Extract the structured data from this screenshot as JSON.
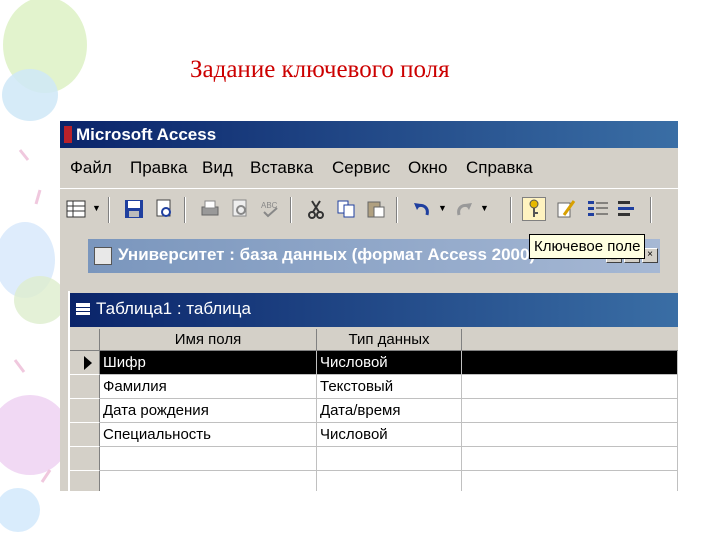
{
  "slide": {
    "title": "Задание ключевого поля"
  },
  "window": {
    "title": "Microsoft Access"
  },
  "menu": [
    "Файл",
    "Правка",
    "Вид",
    "Вставка",
    "Сервис",
    "Окно",
    "Справка"
  ],
  "toolbar": {
    "tooltip": "Ключевое поле",
    "icons": [
      "view-icon",
      "save-icon",
      "print-preview-icon",
      "print-icon",
      "preview-icon",
      "spelling-icon",
      "cut-icon",
      "copy-icon",
      "paste-icon",
      "undo-icon",
      "redo-icon",
      "primary-key-icon",
      "builder-icon",
      "insert-rows-icon",
      "delete-rows-icon"
    ]
  },
  "db_window": {
    "title": "Университет : база данных (формат Access 2000)"
  },
  "table_window": {
    "title": "Таблица1 : таблица",
    "columns": [
      "Имя поля",
      "Тип данных"
    ],
    "rows": [
      {
        "name": "Шифр",
        "type": "Числовой"
      },
      {
        "name": "Фамилия",
        "type": "Текстовый"
      },
      {
        "name": "Дата рождения",
        "type": "Дата/время"
      },
      {
        "name": "Специальность",
        "type": "Числовой"
      },
      {
        "name": "",
        "type": ""
      },
      {
        "name": "",
        "type": ""
      }
    ]
  },
  "colors": {
    "titlebar": "#0a246a",
    "accent": "#cc0000",
    "tooltip_bg": "#ffffe1"
  }
}
